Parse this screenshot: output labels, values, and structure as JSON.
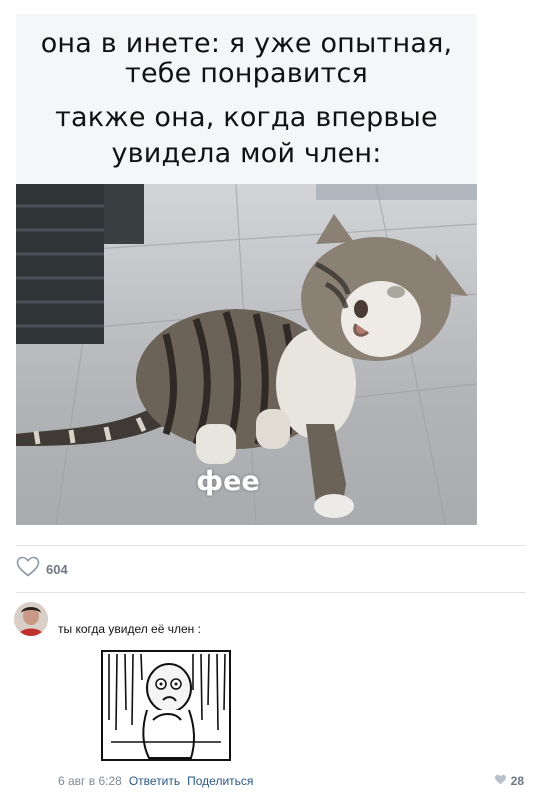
{
  "post": {
    "caption_lines": [
      "она в инете: я уже опытная,",
      "тебе понравится",
      "также она, когда впервые",
      "увидела мой член:"
    ],
    "photo_label": "фее",
    "likes": "604"
  },
  "comment": {
    "text": "ты когда увидел её член :",
    "date": "6 авг в 6:28",
    "reply_label": "Ответить",
    "share_label": "Поделиться",
    "likes": "28"
  },
  "colors": {
    "link": "#2a5885",
    "meta": "#828a99",
    "divider": "#e1e3e6",
    "caption_bg": "#f5f6f8"
  },
  "icons": {
    "post_like": "heart-outline-icon",
    "comment_like": "heart-filled-icon"
  }
}
